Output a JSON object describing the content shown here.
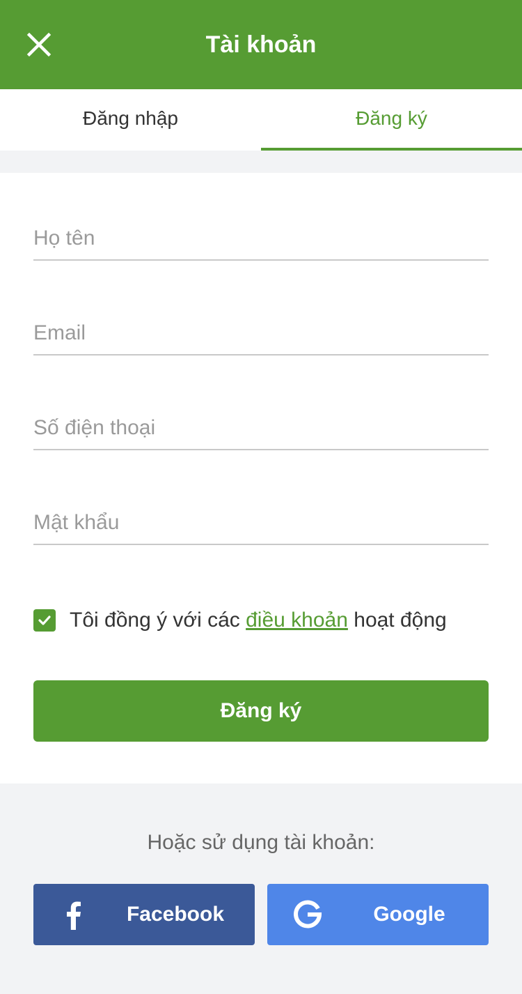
{
  "header": {
    "title": "Tài khoản"
  },
  "tabs": [
    {
      "label": "Đăng nhập",
      "active": false
    },
    {
      "label": "Đăng ký",
      "active": true
    }
  ],
  "form": {
    "full_name_placeholder": "Họ tên",
    "email_placeholder": "Email",
    "phone_placeholder": "Số điện thoại",
    "password_placeholder": "Mật khẩu",
    "agree_checked": true,
    "agree_prefix": "Tôi đồng ý với các ",
    "agree_link": "điều khoản",
    "agree_suffix": " hoạt động",
    "submit_label": "Đăng ký"
  },
  "social": {
    "label": "Hoặc sử dụng tài khoản:",
    "facebook_label": "Facebook",
    "google_label": "Google"
  },
  "colors": {
    "brand_green": "#569c33",
    "facebook_blue": "#3b5998",
    "google_blue": "#4f86e8"
  },
  "icons": [
    "close-icon",
    "checkmark-icon",
    "facebook-icon",
    "google-icon"
  ]
}
